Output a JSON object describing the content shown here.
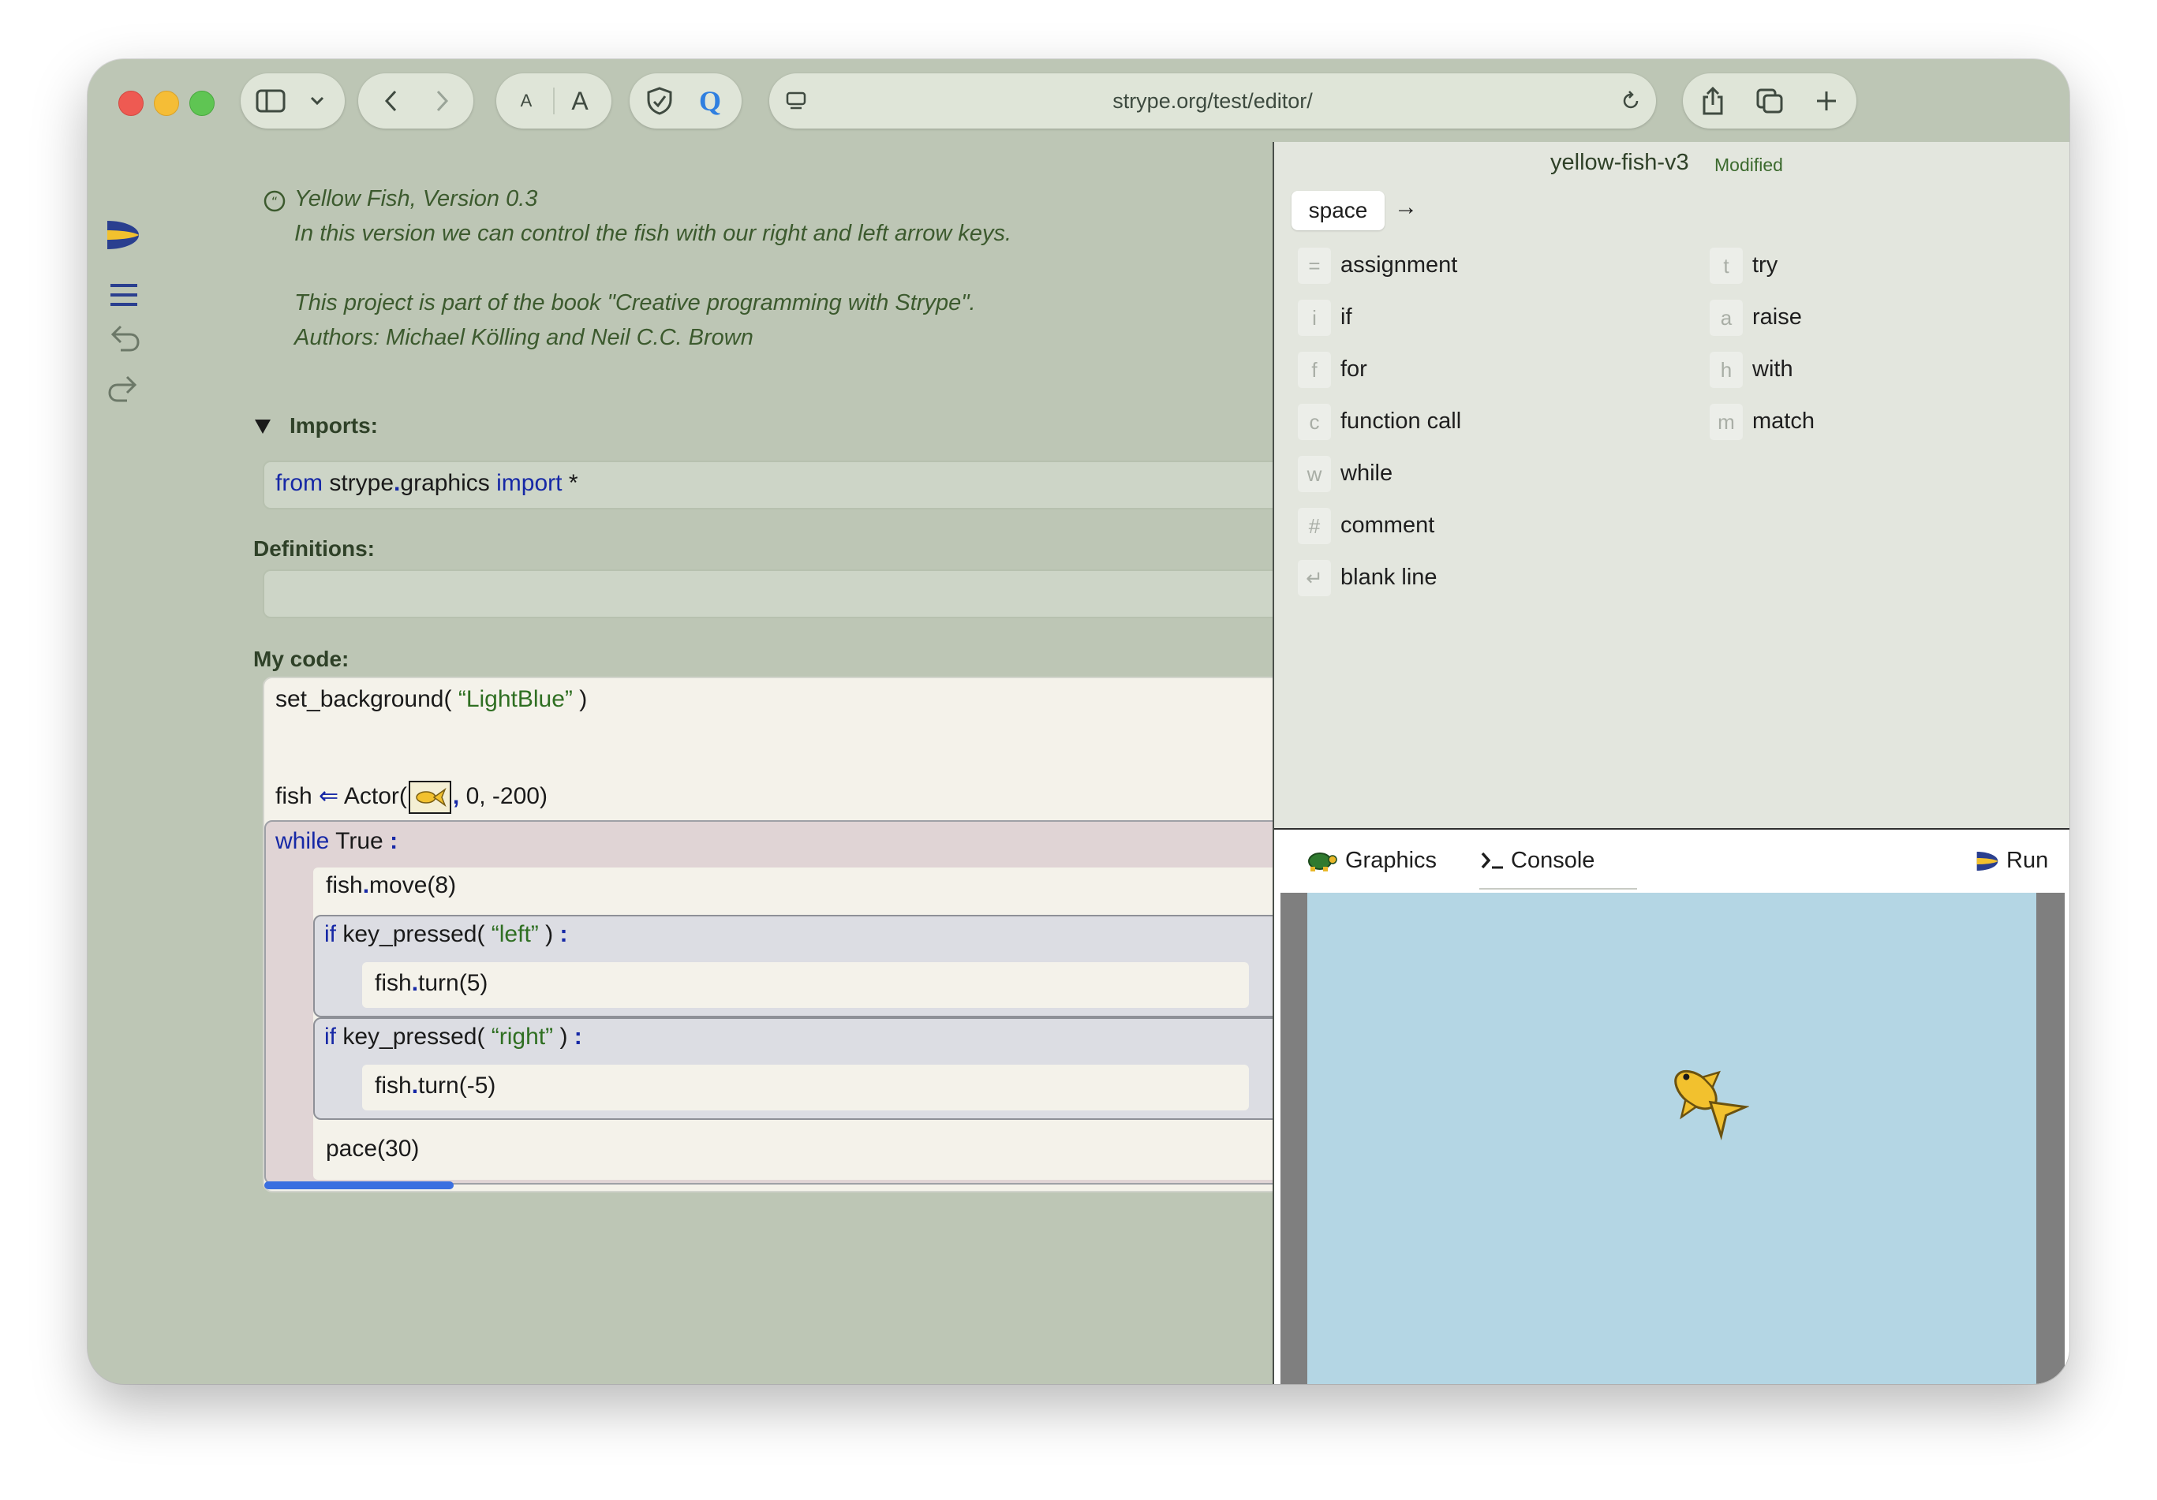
{
  "browser": {
    "url": "strype.org/test/editor/",
    "font_small": "A",
    "font_large": "A",
    "reader_glyph": "Q"
  },
  "project": {
    "name": "yellow-fish-v3",
    "status": "Modified"
  },
  "editor": {
    "comment_lines": [
      "Yellow Fish, Version 0.3",
      "In this version we can control the fish with our right and left arrow keys.",
      "",
      "This project is part of the book \"Creative programming with Strype\".",
      "Authors: Michael Kölling and Neil C.C. Brown"
    ],
    "imports_label": "Imports:",
    "import_stmt": {
      "kw_from": "from",
      "module_a": "strype",
      "module_b": "graphics",
      "kw_import": "import",
      "target": "*"
    },
    "definitions_label": "Definitions:",
    "my_code_label": "My code:",
    "code": {
      "set_background_fn": "set_background",
      "set_background_arg": "“LightBlue”",
      "fish_var": "fish",
      "assign_arrow": "⇐",
      "actor_fn": "Actor",
      "actor_args": "0, -200",
      "while_kw": "while",
      "while_cond": "True",
      "move_call": "move(8)",
      "if_kw": "if",
      "key_pressed_fn": "key_pressed",
      "left_arg": "“left”",
      "turn_left_call": "turn(5)",
      "right_arg": "“right”",
      "turn_right_call": "turn(-5)",
      "pace_call": "pace(30)"
    }
  },
  "commands": {
    "space_key": "space",
    "space_arrow": "→",
    "left_column": [
      {
        "key": "=",
        "label": "assignment"
      },
      {
        "key": "i",
        "label": "if"
      },
      {
        "key": "f",
        "label": "for"
      },
      {
        "key": "c",
        "label": "function call"
      },
      {
        "key": "w",
        "label": "while"
      },
      {
        "key": "#",
        "label": "comment"
      },
      {
        "key": "↵",
        "label": "blank line"
      }
    ],
    "right_column": [
      {
        "key": "t",
        "label": "try"
      },
      {
        "key": "a",
        "label": "raise"
      },
      {
        "key": "h",
        "label": "with"
      },
      {
        "key": "m",
        "label": "match"
      }
    ]
  },
  "tabs": {
    "graphics": "Graphics",
    "console": "Console",
    "run": "Run"
  },
  "colors": {
    "editor_bg": "#bdc6b5",
    "code_bg": "#f4f2ea",
    "while_bg": "#e0d4d5",
    "if_bg": "#dcdde3",
    "keyword": "#1628a6",
    "string": "#2f6f22",
    "graphics_canvas": "#b4d6e4",
    "progress": "#3a6fe0"
  }
}
